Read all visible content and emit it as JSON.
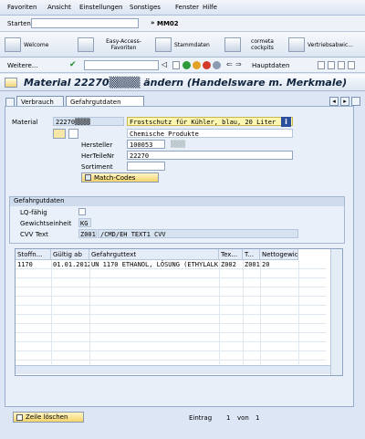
{
  "menu": {
    "items": [
      "Favoriten",
      "Ansicht",
      "Einstellungen",
      "Sonstiges",
      "Fenster",
      "Hilfe"
    ]
  },
  "start": {
    "label": "Starten:",
    "tcode": "MM02"
  },
  "nav": {
    "items": [
      "Welcome",
      "Easy-Access-Favoriten",
      "Stammdaten",
      "cormeta cockpits",
      "Vertriebsabwic..."
    ]
  },
  "toolbar": {
    "weitere": "Weitere...",
    "hauptdaten": "Hauptdaten"
  },
  "title": "Material 22270▒▒▒▒ ändern (Handelsware m. Merkmale)",
  "tabs": [
    "Verbrauch",
    "Gefahrgutdaten"
  ],
  "form": {
    "material_label": "Material",
    "material_value": "22270▒▒▒▒",
    "description": "Frostschutz für Kühler, blau, 20 Liter",
    "chem": "Chemische Produkte",
    "hersteller_label": "Hersteller",
    "hersteller_value": "100053",
    "hersteller_mask": "▒▒▒",
    "hertnr_label": "HerTeileNr",
    "hertnr_value": "22270",
    "sortiment_label": "Sortiment",
    "match_label": "Match-Codes"
  },
  "gefahrgut": {
    "title": "Gefahrgutdaten",
    "lq_label": "LQ-fähig",
    "gewicht_label": "Gewichtseinheit",
    "gewicht_value": "KG",
    "cvv_label": "CVV Text",
    "cvv_code": "Z001",
    "cvv_text": "/CMD/EH_TEXT1_CVV"
  },
  "table": {
    "headers": [
      "Stoffn...",
      "Gültig ab",
      "Gefahrguttext",
      "Tex...",
      "T...",
      "Nettogewic"
    ],
    "rows": [
      [
        "1170",
        "01.01.2012",
        "UN 1170 ETHANOL, LÖSUNG (ETHYLALK...",
        "Z002",
        "Z001",
        "20"
      ]
    ]
  },
  "footer": {
    "delete_label": "Zeile löschen",
    "entry_label": "Eintrag",
    "entry_value": "1",
    "von_label": "von",
    "von_value": "1"
  },
  "colors": {
    "accent": "#2f5a8f",
    "title": "#10243e",
    "match_btn": "#f4d36a"
  }
}
